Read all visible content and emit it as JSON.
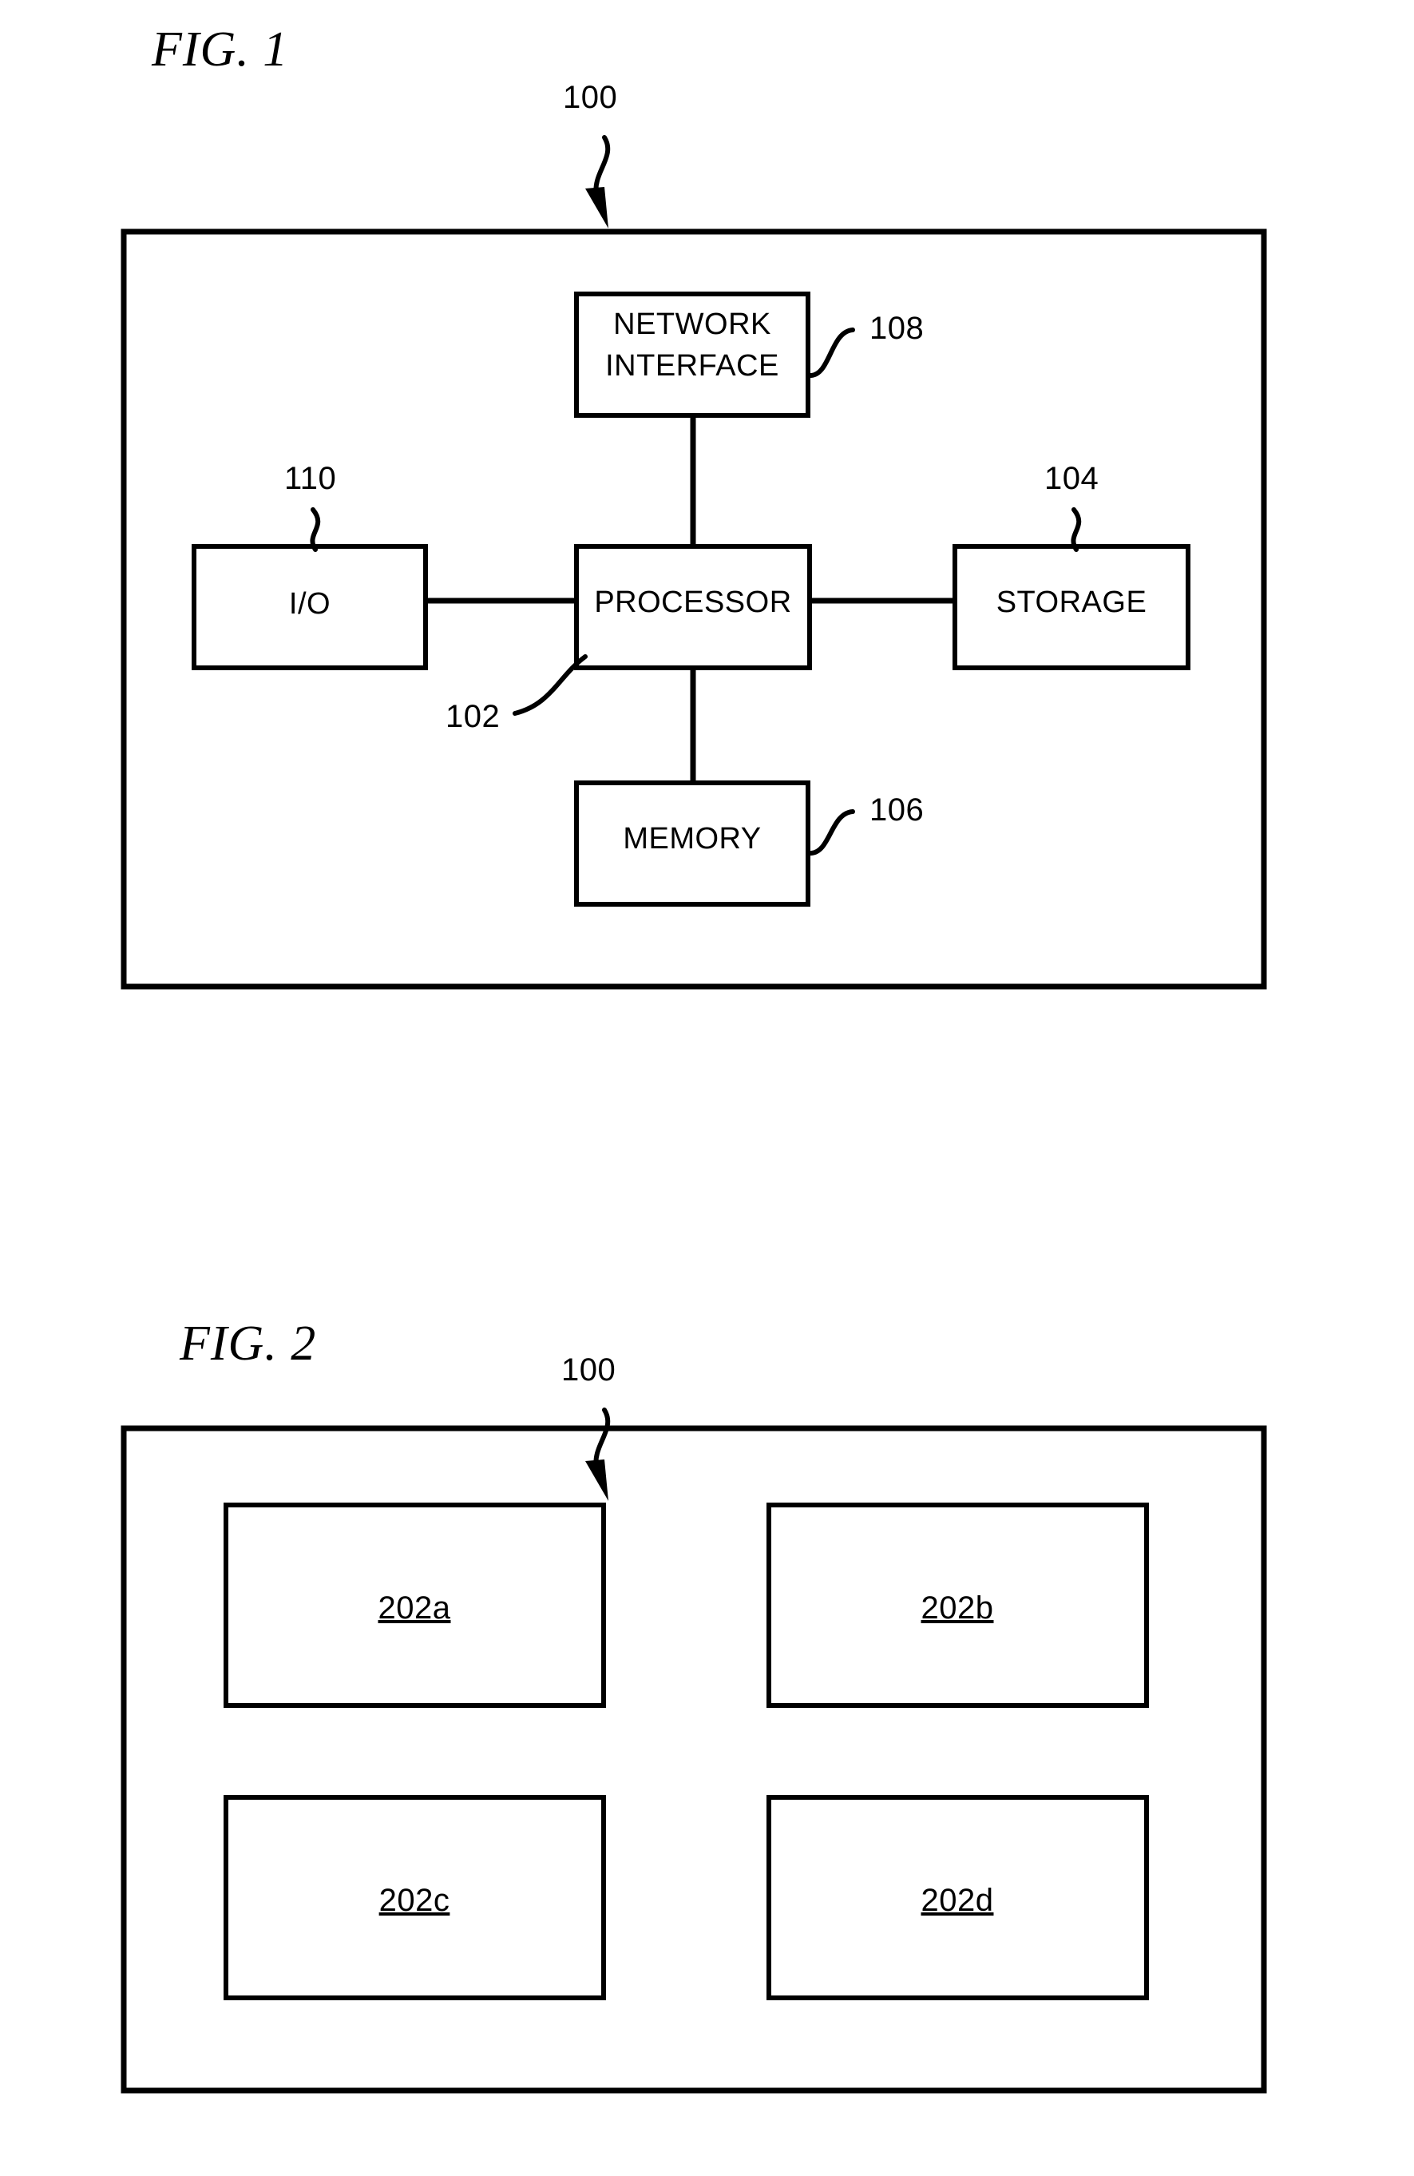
{
  "document": {
    "type": "patent-drawing-sheet",
    "background_color": "#ffffff",
    "line_color": "#000000"
  },
  "figure1": {
    "title": "FIG. 1",
    "system_reference": "100",
    "blocks": [
      {
        "id": "network-interface",
        "label_line1": "NETWORK",
        "label_line2": "INTERFACE",
        "reference": "108"
      },
      {
        "id": "io",
        "label": "I/O",
        "reference": "110"
      },
      {
        "id": "processor",
        "label": "PROCESSOR",
        "reference": "102"
      },
      {
        "id": "storage",
        "label": "STORAGE",
        "reference": "104"
      },
      {
        "id": "memory",
        "label": "MEMORY",
        "reference": "106"
      }
    ],
    "connections": [
      {
        "from": "processor",
        "to": "network-interface"
      },
      {
        "from": "processor",
        "to": "io"
      },
      {
        "from": "processor",
        "to": "storage"
      },
      {
        "from": "processor",
        "to": "memory"
      }
    ]
  },
  "figure2": {
    "title": "FIG. 2",
    "system_reference": "100",
    "modules": [
      {
        "id": "module-a",
        "label": "202a"
      },
      {
        "id": "module-b",
        "label": "202b"
      },
      {
        "id": "module-c",
        "label": "202c"
      },
      {
        "id": "module-d",
        "label": "202d"
      }
    ]
  }
}
